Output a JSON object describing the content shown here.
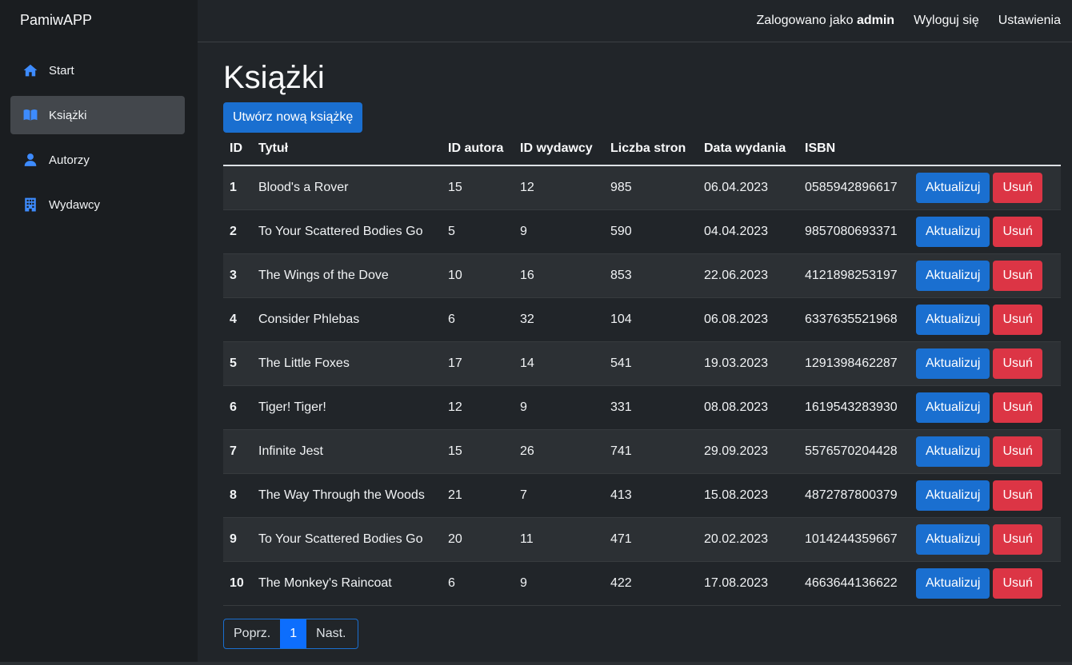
{
  "app": {
    "brand": "PamiwAPP"
  },
  "sidebar": {
    "items": [
      {
        "label": "Start",
        "icon": "home-icon"
      },
      {
        "label": "Książki",
        "icon": "book-icon",
        "active": true
      },
      {
        "label": "Autorzy",
        "icon": "person-icon"
      },
      {
        "label": "Wydawcy",
        "icon": "building-icon"
      }
    ]
  },
  "header": {
    "logged_as_prefix": "Zalogowano jako",
    "username": "admin",
    "logout": "Wyloguj się",
    "settings": "Ustawienia"
  },
  "page": {
    "title": "Książki",
    "create_button": "Utwórz nową książkę"
  },
  "table": {
    "columns": [
      "ID",
      "Tytuł",
      "ID autora",
      "ID wydawcy",
      "Liczba stron",
      "Data wydania",
      "ISBN"
    ],
    "update_label": "Aktualizuj",
    "delete_label": "Usuń",
    "rows": [
      [
        "1",
        "Blood's a Rover",
        "15",
        "12",
        "985",
        "06.04.2023",
        "0585942896617"
      ],
      [
        "2",
        "To Your Scattered Bodies Go",
        "5",
        "9",
        "590",
        "04.04.2023",
        "9857080693371"
      ],
      [
        "3",
        "The Wings of the Dove",
        "10",
        "16",
        "853",
        "22.06.2023",
        "4121898253197"
      ],
      [
        "4",
        "Consider Phlebas",
        "6",
        "32",
        "104",
        "06.08.2023",
        "6337635521968"
      ],
      [
        "5",
        "The Little Foxes",
        "17",
        "14",
        "541",
        "19.03.2023",
        "1291398462287"
      ],
      [
        "6",
        "Tiger! Tiger!",
        "12",
        "9",
        "331",
        "08.08.2023",
        "1619543283930"
      ],
      [
        "7",
        "Infinite Jest",
        "15",
        "26",
        "741",
        "29.09.2023",
        "5576570204428"
      ],
      [
        "8",
        "The Way Through the Woods",
        "21",
        "7",
        "413",
        "15.08.2023",
        "4872787800379"
      ],
      [
        "9",
        "To Your Scattered Bodies Go",
        "20",
        "11",
        "471",
        "20.02.2023",
        "1014244359667"
      ],
      [
        "10",
        "The Monkey's Raincoat",
        "6",
        "9",
        "422",
        "17.08.2023",
        "4663644136622"
      ]
    ]
  },
  "pagination": {
    "prev": "Poprz.",
    "current": "1",
    "next": "Nast."
  },
  "colors": {
    "accent": "#1a6fd0",
    "danger": "#dc3545",
    "icon": "#3d8bfd"
  }
}
